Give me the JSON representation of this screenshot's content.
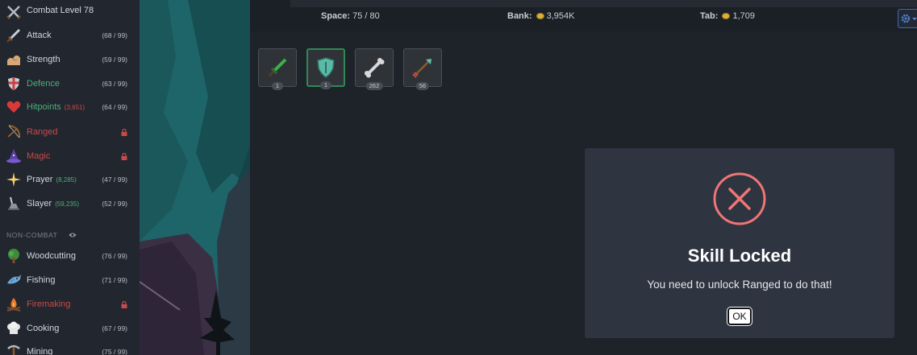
{
  "sidebar": {
    "combat_level": "Combat Level 78",
    "combat_skills": [
      {
        "name": "Attack",
        "level": "(68 / 99)",
        "icon": "sword-icon",
        "style": "normal",
        "sub": ""
      },
      {
        "name": "Strength",
        "level": "(59 / 99)",
        "icon": "flexed-arm-icon",
        "style": "normal",
        "sub": ""
      },
      {
        "name": "Defence",
        "level": "(63 / 99)",
        "icon": "shield-icon",
        "style": "green",
        "sub": ""
      },
      {
        "name": "Hitpoints",
        "level": "(64 / 99)",
        "icon": "heart-icon",
        "style": "green",
        "sub": "(3,651)"
      },
      {
        "name": "Ranged",
        "level": "",
        "icon": "bow-icon",
        "style": "red",
        "sub": "",
        "locked": true
      },
      {
        "name": "Magic",
        "level": "",
        "icon": "wizard-hat-icon",
        "style": "red",
        "sub": "",
        "locked": true
      },
      {
        "name": "Prayer",
        "level": "(47 / 99)",
        "icon": "sparkle-icon",
        "style": "normal",
        "sub": "(8,285)"
      },
      {
        "name": "Slayer",
        "level": "(52 / 99)",
        "icon": "slayer-icon",
        "style": "normal",
        "sub": "(59,235)"
      }
    ],
    "noncombat_header": "NON-COMBAT",
    "noncombat_skills": [
      {
        "name": "Woodcutting",
        "level": "(76 / 99)",
        "icon": "tree-icon",
        "style": "normal"
      },
      {
        "name": "Fishing",
        "level": "(71 / 99)",
        "icon": "fish-icon",
        "style": "normal"
      },
      {
        "name": "Firemaking",
        "level": "",
        "icon": "campfire-icon",
        "style": "red",
        "locked": true
      },
      {
        "name": "Cooking",
        "level": "(67 / 99)",
        "icon": "chef-hat-icon",
        "style": "normal"
      },
      {
        "name": "Mining",
        "level": "(75 / 99)",
        "icon": "pickaxe-icon",
        "style": "normal"
      }
    ]
  },
  "bank_bar": {
    "space_label": "Space:",
    "space_value": "75 / 80",
    "bank_label": "Bank:",
    "bank_value": "3,954K",
    "tab_label": "Tab:",
    "tab_value": "1,709"
  },
  "bank_items": [
    {
      "qty": "1",
      "icon": "green-sword-icon",
      "selected": false
    },
    {
      "qty": "1",
      "icon": "teal-shield-icon",
      "selected": true
    },
    {
      "qty": "262",
      "icon": "bone-icon",
      "selected": false
    },
    {
      "qty": "56",
      "icon": "arrow-icon",
      "selected": false
    }
  ],
  "modal": {
    "title": "Skill Locked",
    "message": "You need to unlock Ranged to do that!",
    "ok_label": "OK",
    "icon": "error-x-icon"
  },
  "colors": {
    "locked_red": "#c84b4b",
    "xp_green": "#4caf7a",
    "error_ring": "#f07575"
  }
}
